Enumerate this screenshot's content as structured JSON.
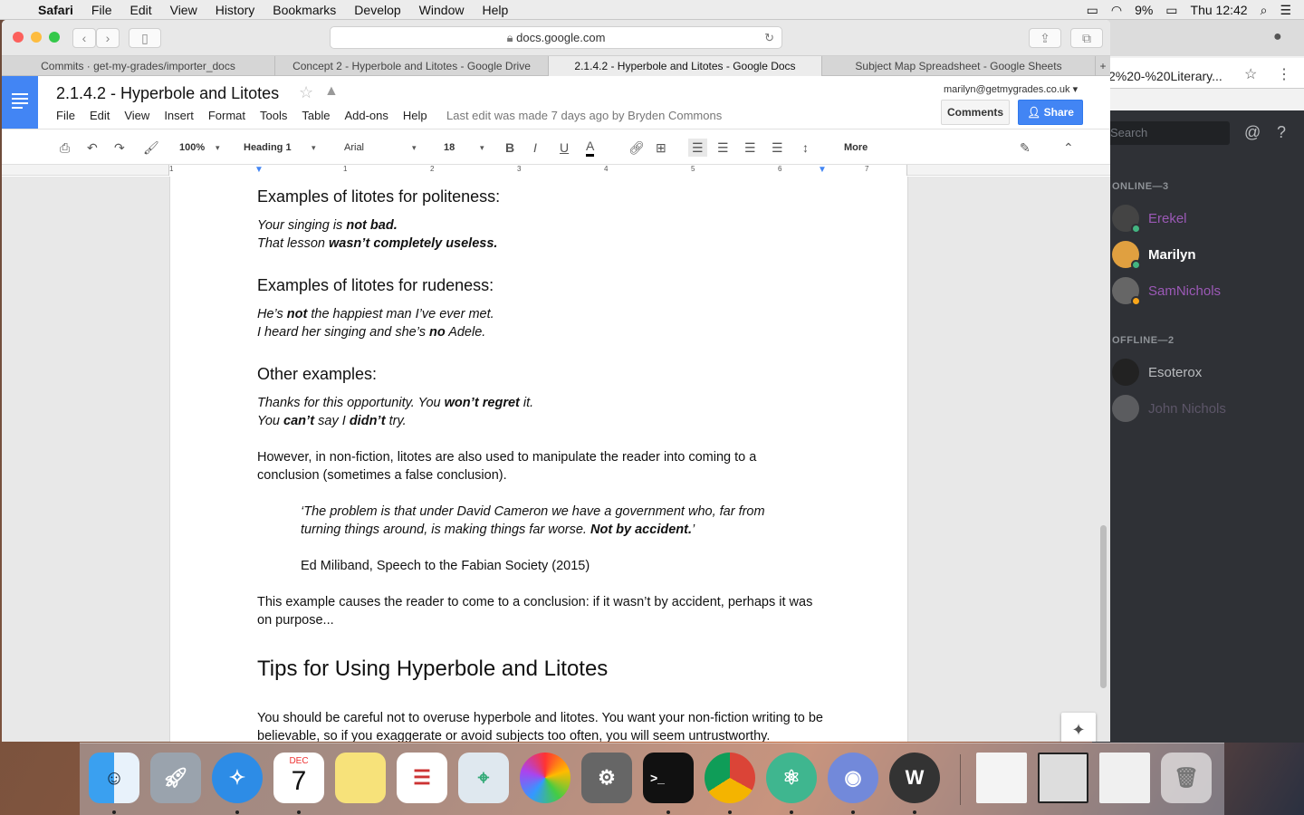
{
  "menubar": {
    "app": "Safari",
    "items": [
      "File",
      "Edit",
      "View",
      "History",
      "Bookmarks",
      "Develop",
      "Window",
      "Help"
    ],
    "battery": "9%",
    "clock": "Thu 12:42"
  },
  "safari": {
    "url": "docs.google.com",
    "tabs": [
      "Commits · get-my-grades/importer_docs",
      "Concept 2 - Hyperbole and Litotes - Google Drive",
      "2.1.4.2 - Hyperbole and Litotes - Google Docs",
      "Subject Map Spreadsheet - Google Sheets"
    ]
  },
  "chrome": {
    "address": "2%20-%20Literary..."
  },
  "docs": {
    "title": "2.1.4.2 - Hyperbole and Litotes",
    "menu": [
      "File",
      "Edit",
      "View",
      "Insert",
      "Format",
      "Tools",
      "Table",
      "Add-ons",
      "Help"
    ],
    "last_edit": "Last edit was made 7 days ago by Bryden Commons",
    "account": "marilyn@getmygrades.co.uk",
    "comments_label": "Comments",
    "share_label": "Share",
    "toolbar": {
      "zoom": "100%",
      "style": "Heading 1",
      "font": "Arial",
      "size": "18",
      "more": "More"
    },
    "ruler_ticks": [
      "1",
      "1",
      "2",
      "3",
      "4",
      "5",
      "6",
      "7"
    ]
  },
  "content": {
    "h_politeness": "Examples of litotes for politeness:",
    "pol1_a": "Your singing is ",
    "pol1_b": "not bad.",
    "pol2_a": "That lesson ",
    "pol2_b": "wasn’t completely useless.",
    "h_rudeness": "Examples of litotes for rudeness:",
    "rud1_a": "He’s ",
    "rud1_b": "not",
    "rud1_c": " the happiest man I’ve ever met.",
    "rud2_a": "I heard her singing and she’s ",
    "rud2_b": "no",
    "rud2_c": " Adele.",
    "h_other": "Other examples:",
    "oth1_a": "Thanks for this opportunity. You ",
    "oth1_b": "won’t regret",
    "oth1_c": " it.",
    "oth2_a": "You ",
    "oth2_b": "can’t",
    "oth2_c": " say I ",
    "oth2_d": "didn’t",
    "oth2_e": " try.",
    "nonfiction": "However, in non-fiction, litotes are also used to manipulate the reader into coming to a conclusion (sometimes a false conclusion).",
    "quote_a": "‘The problem is that under David Cameron we have a government who, far from turning things around, is making things far worse. ",
    "quote_b": "Not by accident.",
    "quote_c": "’",
    "source": "Ed Miliband, Speech to the Fabian Society (2015)",
    "conclusion": "This example causes the reader to come to a conclusion: if it wasn’t by accident, perhaps it was on purpose...",
    "h_tips": "Tips for Using Hyperbole and Litotes",
    "tips_text": "You should be careful not to overuse hyperbole and litotes. You want your non-fiction writing to be believable, so if you exaggerate or avoid subjects too often, you will seem untrustworthy."
  },
  "discord": {
    "search_placeholder": "Search",
    "online_header": "ONLINE—3",
    "offline_header": "OFFLINE—2",
    "online": [
      {
        "name": "Erekel",
        "color": "#9b59b6",
        "status": "#43b581"
      },
      {
        "name": "Marilyn",
        "color": "#ffffff",
        "status": "#43b581"
      },
      {
        "name": "SamNichols",
        "color": "#9b59b6",
        "status": "#faa61a"
      }
    ],
    "offline": [
      {
        "name": "Esoterox",
        "color": "#b9bbbe"
      },
      {
        "name": "John Nichols",
        "color": "#6c5a7a"
      }
    ]
  },
  "dock": {
    "calendar_month": "DEC",
    "calendar_day": "7"
  }
}
